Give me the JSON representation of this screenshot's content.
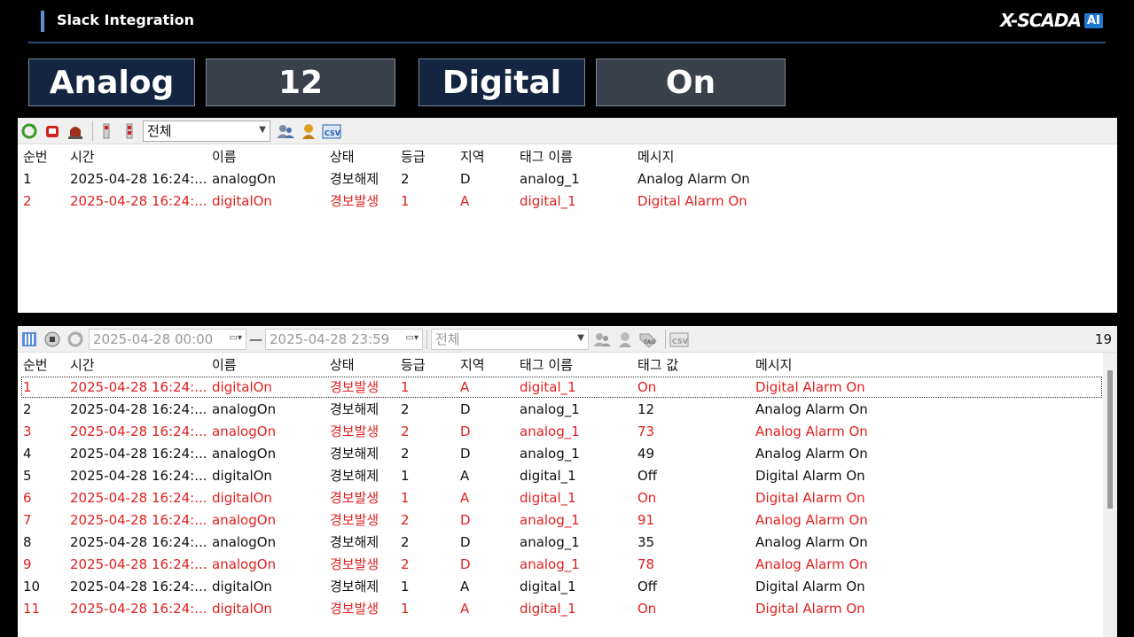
{
  "header": {
    "title": "Slack Integration",
    "logo_text": "X-SCADA",
    "logo_badge": "AI"
  },
  "tiles": [
    {
      "label": "Analog",
      "value": "12"
    },
    {
      "label": "Digital",
      "value": "On"
    }
  ],
  "colors": {
    "active": "#e02020",
    "normal": "#111111",
    "tile_label_bg": "#142541",
    "tile_value_bg": "#3a414a",
    "accent": "#5b8fd8"
  },
  "current_alarms": {
    "toolbar": {
      "icons": [
        "refresh-icon",
        "siren-on-icon",
        "siren-off-icon",
        "ack-one-icon",
        "ack-all-icon",
        "user-group-icon",
        "user-icon",
        "csv-export-icon"
      ],
      "filter_value": "전체"
    },
    "columns": [
      "순번",
      "시간",
      "이름",
      "상태",
      "등급",
      "지역",
      "태그 이름",
      "메시지"
    ],
    "rows": [
      {
        "state": "normal",
        "cells": [
          "1",
          "2025-04-28 16:24:...",
          "analogOn",
          "경보해제",
          "2",
          "D",
          "analog_1",
          "Analog Alarm On"
        ]
      },
      {
        "state": "active",
        "cells": [
          "2",
          "2025-04-28 16:24:...",
          "digitalOn",
          "경보발생",
          "1",
          "A",
          "digital_1",
          "Digital Alarm On"
        ]
      }
    ]
  },
  "history": {
    "toolbar": {
      "icons": [
        "grid-icon",
        "stop-icon",
        "reload-icon"
      ],
      "start_date": "2025-04-28 00:00",
      "separator": "—",
      "end_date": "2025-04-28 23:59",
      "filter_value": "전체",
      "icons_right": [
        "user-group-icon",
        "user-icon",
        "tag-icon",
        "csv-export-icon"
      ],
      "count": "19"
    },
    "columns": [
      "순번",
      "시간",
      "이름",
      "상태",
      "등급",
      "지역",
      "태그 이름",
      "태그 값",
      "메시지"
    ],
    "rows": [
      {
        "state": "active",
        "cells": [
          "1",
          "2025-04-28 16:24:...",
          "digitalOn",
          "경보발생",
          "1",
          "A",
          "digital_1",
          "On",
          "Digital Alarm On"
        ]
      },
      {
        "state": "normal",
        "cells": [
          "2",
          "2025-04-28 16:24:...",
          "analogOn",
          "경보해제",
          "2",
          "D",
          "analog_1",
          "12",
          "Analog Alarm On"
        ]
      },
      {
        "state": "active",
        "cells": [
          "3",
          "2025-04-28 16:24:...",
          "analogOn",
          "경보발생",
          "2",
          "D",
          "analog_1",
          "73",
          "Analog Alarm On"
        ]
      },
      {
        "state": "normal",
        "cells": [
          "4",
          "2025-04-28 16:24:...",
          "analogOn",
          "경보해제",
          "2",
          "D",
          "analog_1",
          "49",
          "Analog Alarm On"
        ]
      },
      {
        "state": "normal",
        "cells": [
          "5",
          "2025-04-28 16:24:...",
          "digitalOn",
          "경보해제",
          "1",
          "A",
          "digital_1",
          "Off",
          "Digital Alarm On"
        ]
      },
      {
        "state": "active",
        "cells": [
          "6",
          "2025-04-28 16:24:...",
          "digitalOn",
          "경보발생",
          "1",
          "A",
          "digital_1",
          "On",
          "Digital Alarm On"
        ]
      },
      {
        "state": "active",
        "cells": [
          "7",
          "2025-04-28 16:24:...",
          "analogOn",
          "경보발생",
          "2",
          "D",
          "analog_1",
          "91",
          "Analog Alarm On"
        ]
      },
      {
        "state": "normal",
        "cells": [
          "8",
          "2025-04-28 16:24:...",
          "analogOn",
          "경보해제",
          "2",
          "D",
          "analog_1",
          "35",
          "Analog Alarm On"
        ]
      },
      {
        "state": "active",
        "cells": [
          "9",
          "2025-04-28 16:24:...",
          "analogOn",
          "경보발생",
          "2",
          "D",
          "analog_1",
          "78",
          "Analog Alarm On"
        ]
      },
      {
        "state": "normal",
        "cells": [
          "10",
          "2025-04-28 16:24:...",
          "digitalOn",
          "경보해제",
          "1",
          "A",
          "digital_1",
          "Off",
          "Digital Alarm On"
        ]
      },
      {
        "state": "active",
        "cells": [
          "11",
          "2025-04-28 16:24:...",
          "digitalOn",
          "경보발생",
          "1",
          "A",
          "digital_1",
          "On",
          "Digital Alarm On"
        ]
      }
    ]
  }
}
